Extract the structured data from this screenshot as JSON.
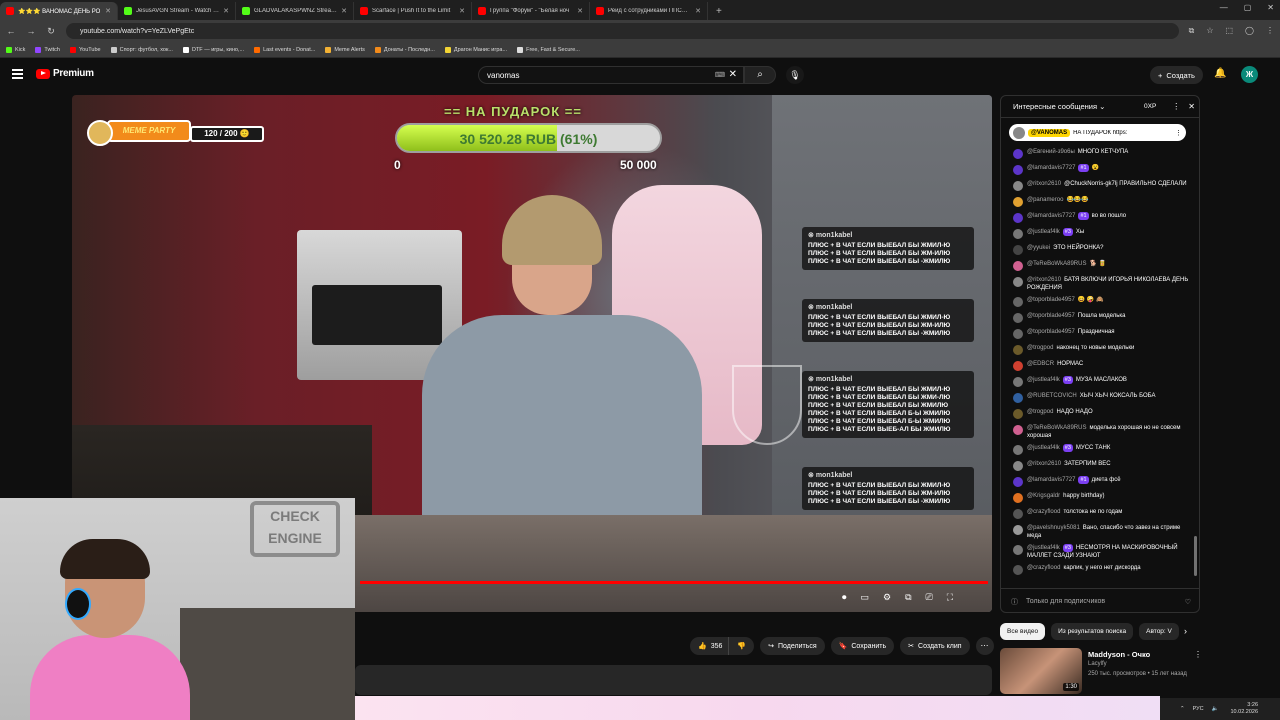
{
  "browser": {
    "tabs": [
      {
        "label": "⭐⭐⭐ ВАНОМАС ДЕНЬ РО",
        "color": "#ff0000",
        "active": true
      },
      {
        "label": "JesusAVGN Stream - Watch Liv",
        "color": "#53fc18",
        "active": false
      },
      {
        "label": "GLADVALAKASPWNZ Stream -",
        "color": "#53fc18",
        "active": false
      },
      {
        "label": "Scarface | Push It to the Limit",
        "color": "#ff0000",
        "active": false
      },
      {
        "label": "Группа \"Форум\" - \"Белая ноч",
        "color": "#ff0000",
        "active": false
      },
      {
        "label": "Рейд с сотрудниками ППСП У",
        "color": "#ff0000",
        "active": false
      }
    ],
    "url": "youtube.com/watch?v=YeZLVePgEtc",
    "bookmarks": [
      {
        "label": "Kick",
        "color": "#53fc18"
      },
      {
        "label": "Twitch",
        "color": "#9146ff"
      },
      {
        "label": "YouTube",
        "color": "#ff0000"
      },
      {
        "label": "Спорт: футбол, хок...",
        "color": "#cccccc"
      },
      {
        "label": "DTF — игры, кино,...",
        "color": "#ffffff"
      },
      {
        "label": "Last events - Donat...",
        "color": "#ff6a00"
      },
      {
        "label": "Meme Alerts",
        "color": "#f2b134"
      },
      {
        "label": "Донаты - Последн...",
        "color": "#f28b1b"
      },
      {
        "label": "Драгон Манис игра...",
        "color": "#f2d434"
      },
      {
        "label": "Free, Fast & Secure...",
        "color": "#dddddd"
      }
    ]
  },
  "youtube": {
    "logo": "Premium",
    "search_value": "vanomas",
    "create_label": "Создать",
    "avatar_letter": "Ж"
  },
  "overlay": {
    "donation_title": "== НА ПУДАРОК ==",
    "donation_amount": "30 520.28 RUB (61%)",
    "donation_progress": 0.61,
    "donation_min": "0",
    "donation_max": "50 000",
    "meme_label": "MEME PARTY",
    "meme_count": "120 / 200 🙂",
    "cam_sign": "CHECK ENGINE",
    "onscreen_messages": [
      {
        "author": "mon1kabel",
        "text": "ПЛЮС + В ЧАТ ЕСЛИ ВЫЕБАЛ БЫ ЖМИЛ-Ю ПЛЮС + В ЧАТ ЕСЛИ ВЫЕБАЛ БЫ ЖМ-ИЛЮ ПЛЮС + В ЧАТ ЕСЛИ ВЫЕБАЛ БЫ -ЖМИЛЮ"
      },
      {
        "author": "mon1kabel",
        "text": "ПЛЮС + В ЧАТ ЕСЛИ ВЫЕБАЛ БЫ ЖМИЛ-Ю ПЛЮС + В ЧАТ ЕСЛИ ВЫЕБАЛ БЫ ЖМ-ИЛЮ ПЛЮС + В ЧАТ ЕСЛИ ВЫЕБАЛ БЫ -ЖМИЛЮ"
      },
      {
        "author": "mon1kabel",
        "text": "ПЛЮС + В ЧАТ ЕСЛИ ВЫЕБАЛ БЫ ЖМИЛ-Ю ПЛЮС + В ЧАТ ЕСЛИ ВЫЕБАЛ БЫ ЖМИ-ЛЮ ПЛЮС + В ЧАТ ЕСЛИ ВЫЕБАЛ БЫ ЖМИЛЮ ПЛЮС + В ЧАТ ЕСЛИ ВЫЕБАЛ Б-Ы ЖМИЛЮ ПЛЮС + В ЧАТ ЕСЛИ ВЫЕБАЛ Б-Ы ЖМИЛЮ ПЛЮС + В ЧАТ ЕСЛИ ВЫЕБ-АЛ БЫ ЖМИЛЮ"
      },
      {
        "author": "mon1kabel",
        "text": "ПЛЮС + В ЧАТ ЕСЛИ ВЫЕБАЛ БЫ ЖМИЛ-Ю ПЛЮС + В ЧАТ ЕСЛИ ВЫЕБАЛ БЫ ЖМ-ИЛЮ ПЛЮС + В ЧАТ ЕСЛИ ВЫЕБАЛ БЫ -ЖМИЛЮ"
      }
    ]
  },
  "actions": {
    "likes": "356",
    "share": "Поделиться",
    "save": "Сохранить",
    "clip": "Создать клип"
  },
  "chat": {
    "title": "Интересные сообщения",
    "xp": "0XP",
    "pinned_author": "@VANOMAS",
    "pinned_text": "НА ПУДАРОК https:",
    "input_placeholder": "Только для подписчиков",
    "messages": [
      {
        "author": "@Евгений-з9о6ы",
        "badge": "",
        "text": "МНОГО КЕТЧУПА",
        "color": "#5c35c9"
      },
      {
        "author": "@lamardavis7727",
        "badge": "#1",
        "text": "😮",
        "color": "#5c35c9"
      },
      {
        "author": "@ritxon2610",
        "badge": "",
        "text": "@ChuckNorris-gk7lj ПРАВИЛЬНО СДЕЛАЛИ",
        "color": "#888"
      },
      {
        "author": "@panameroo",
        "badge": "",
        "text": "😂😂😂",
        "color": "#e0a030"
      },
      {
        "author": "@lamardavis7727",
        "badge": "#1",
        "text": "во во пошло",
        "color": "#5c35c9"
      },
      {
        "author": "@justleaf4lk",
        "badge": "#3",
        "text": "Хы",
        "color": "#777"
      },
      {
        "author": "@yyukei",
        "badge": "",
        "text": "ЭТО НЕЙРОНКА?",
        "color": "#444"
      },
      {
        "author": "@TeReBoWkA89RUS",
        "badge": "",
        "text": "🐕 🥫",
        "color": "#d06090"
      },
      {
        "author": "@ritxon2610",
        "badge": "",
        "text": "БАТЯ ВКЛЮЧИ ИГОРЬЯ НИКОЛАЕВА ДЕНЬ РОЖДЕНИЯ",
        "color": "#888"
      },
      {
        "author": "@toporblade4957",
        "badge": "",
        "text": "😄 🤪 🙈",
        "color": "#666"
      },
      {
        "author": "@toporblade4957",
        "badge": "",
        "text": "Пошла моделька",
        "color": "#666"
      },
      {
        "author": "@toporblade4957",
        "badge": "",
        "text": "Праздничная",
        "color": "#666"
      },
      {
        "author": "@trogpod",
        "badge": "",
        "text": "наконец то новые модельки",
        "color": "#6b5a2a"
      },
      {
        "author": "@EDBCR",
        "badge": "",
        "text": "НОРМАС",
        "color": "#d04030"
      },
      {
        "author": "@justleaf4lk",
        "badge": "#3",
        "text": "МУЗА МАСЛАКОВ",
        "color": "#777"
      },
      {
        "author": "@RUBETCOVICH",
        "badge": "",
        "text": "ХЫЧ ХЫЧ КОКСАЛЬ БОБА",
        "color": "#3060a0"
      },
      {
        "author": "@trogpod",
        "badge": "",
        "text": "НАДО НАДО",
        "color": "#6b5a2a"
      },
      {
        "author": "@TeReBoWkA89RUS",
        "badge": "",
        "text": "моделька хорошая но не совсем хорошая",
        "color": "#d06090"
      },
      {
        "author": "@justleaf4lk",
        "badge": "#3",
        "text": "МУСС ТАНК",
        "color": "#777"
      },
      {
        "author": "@ritxon2610",
        "badge": "",
        "text": "ЗАТЕРПИМ ВЕС",
        "color": "#888"
      },
      {
        "author": "@lamardavis7727",
        "badge": "#1",
        "text": "диета фсё",
        "color": "#5c35c9"
      },
      {
        "author": "@Krigsgaldr",
        "badge": "",
        "text": "happy birthday)",
        "color": "#e07020"
      },
      {
        "author": "@crazyflood",
        "badge": "",
        "text": "толстока не по годам",
        "color": "#555"
      },
      {
        "author": "@pavelshnuyk5081",
        "badge": "",
        "text": "Вано, спасибо что завез на стриме меда",
        "color": "#999"
      },
      {
        "author": "@justleaf4lk",
        "badge": "#3",
        "text": "НЕСМОТРЯ НА МАСКИРОВОЧНЫЙ МАЛЛЕТ СЗАДИ УЗНАЮТ",
        "color": "#777"
      },
      {
        "author": "@crazyflood",
        "badge": "",
        "text": "карлик, у него нет дискорда",
        "color": "#555"
      }
    ]
  },
  "related": {
    "chips": [
      "Все видео",
      "Из результатов поиска",
      "Автор: V"
    ],
    "title": "Maddyson - Очко",
    "channel": "Lacylfy",
    "meta": "250 тыс. просмотров • 15 лет назад",
    "duration": "1:30"
  },
  "taskbar": {
    "lang": "РУС",
    "time": "3:26",
    "date": "10.02.2026"
  }
}
